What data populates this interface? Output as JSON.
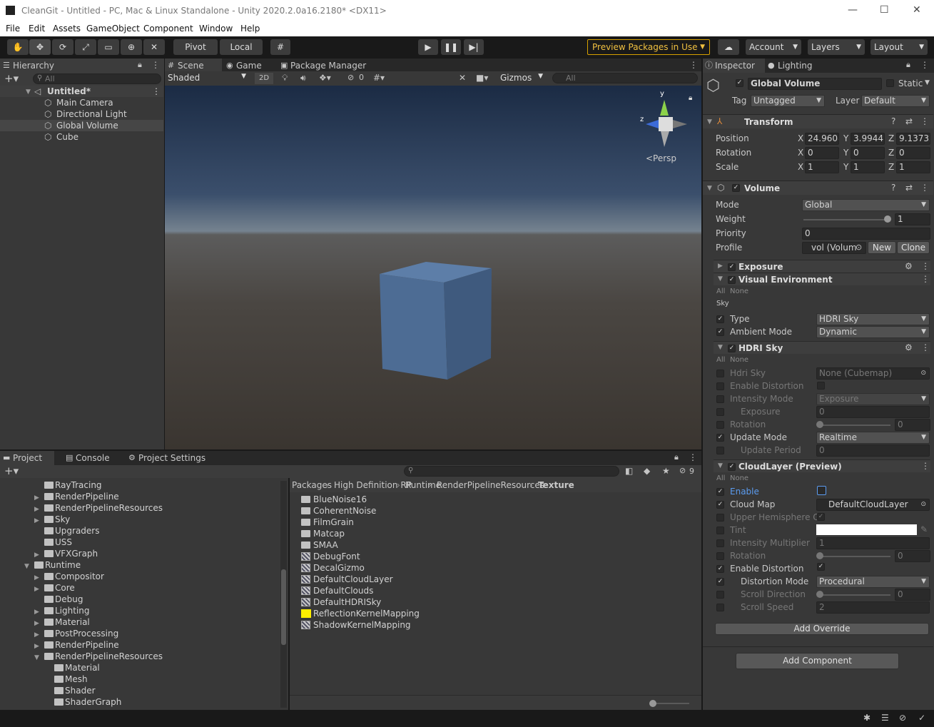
{
  "window": {
    "title": "CleanGit - Untitled - PC, Mac & Linux Standalone - Unity 2020.2.0a16.2180* <DX11>",
    "minimize": "—",
    "maximize": "☐",
    "close": "✕"
  },
  "menu": [
    "File",
    "Edit",
    "Assets",
    "GameObject",
    "Component",
    "Window",
    "Help"
  ],
  "toolbar": {
    "pivot": "Pivot",
    "local": "Local",
    "preview_packages": "Preview Packages in Use",
    "account": "Account",
    "layers": "Layers",
    "layout": "Layout"
  },
  "hierarchy": {
    "tab": "Hierarchy",
    "search_placeholder": "All",
    "scene": "Untitled*",
    "items": [
      "Main Camera",
      "Directional Light",
      "Global Volume",
      "Cube"
    ]
  },
  "scene": {
    "tabs": [
      "Scene",
      "Game",
      "Package Manager"
    ],
    "shading": "Shaded",
    "mode_2d": "2D",
    "hidden_count": "0",
    "gizmos": "Gizmos",
    "search_placeholder": "All",
    "persp": "<Persp",
    "axis_y": "y",
    "axis_x": "x",
    "axis_z": "z"
  },
  "inspector": {
    "tabs": [
      "Inspector",
      "Lighting"
    ],
    "object_name": "Global Volume",
    "static": "Static",
    "tag_label": "Tag",
    "tag": "Untagged",
    "layer_label": "Layer",
    "layer": "Default",
    "transform": {
      "title": "Transform",
      "position_label": "Position",
      "rotation_label": "Rotation",
      "scale_label": "Scale",
      "position": [
        "24.9608",
        "3.9944",
        "9.13732"
      ],
      "rotation": [
        "0",
        "0",
        "0"
      ],
      "scale": [
        "1",
        "1",
        "1"
      ],
      "axes": [
        "X",
        "Y",
        "Z"
      ]
    },
    "volume": {
      "title": "Volume",
      "mode_label": "Mode",
      "mode": "Global",
      "weight_label": "Weight",
      "weight": "1",
      "priority_label": "Priority",
      "priority": "0",
      "profile_label": "Profile",
      "profile": "vol (Volum",
      "new": "New",
      "clone": "Clone"
    },
    "exposure": {
      "title": "Exposure"
    },
    "visual_env": {
      "title": "Visual Environment",
      "all": "All",
      "none": "None",
      "sky": "Sky",
      "type_label": "Type",
      "type": "HDRI Sky",
      "ambient_label": "Ambient Mode",
      "ambient": "Dynamic"
    },
    "hdri": {
      "title": "HDRI Sky",
      "all": "All",
      "none": "None",
      "hdri_label": "Hdri Sky",
      "hdri": "None (Cubemap)",
      "enable_distortion": "Enable Distortion",
      "intensity_mode_label": "Intensity Mode",
      "intensity_mode": "Exposure",
      "exposure_label": "Exposure",
      "exposure": "0",
      "rotation_label": "Rotation",
      "rotation": "0",
      "update_mode_label": "Update Mode",
      "update_mode": "Realtime",
      "update_period_label": "Update Period",
      "update_period": "0"
    },
    "cloud": {
      "title": "CloudLayer (Preview)",
      "all": "All",
      "none": "None",
      "enable": "Enable",
      "cloud_map_label": "Cloud Map",
      "cloud_map": "DefaultCloudLayer",
      "upper": "Upper Hemisphere Or",
      "tint": "Tint",
      "intensity_label": "Intensity Multiplier",
      "intensity": "1",
      "rotation_label": "Rotation",
      "rotation": "0",
      "enable_distortion": "Enable Distortion",
      "distortion_mode_label": "Distortion Mode",
      "distortion_mode": "Procedural",
      "scroll_dir_label": "Scroll Direction",
      "scroll_dir": "0",
      "scroll_speed_label": "Scroll Speed",
      "scroll_speed": "2"
    },
    "add_override": "Add Override",
    "add_component": "Add Component"
  },
  "project": {
    "tabs": [
      "Project",
      "Console",
      "Project Settings"
    ],
    "hidden_count": "9",
    "tree": [
      {
        "label": "RayTracing",
        "indent": 1,
        "arrow": ""
      },
      {
        "label": "RenderPipeline",
        "indent": 1,
        "arrow": "▶"
      },
      {
        "label": "RenderPipelineResources",
        "indent": 1,
        "arrow": "▶"
      },
      {
        "label": "Sky",
        "indent": 1,
        "arrow": "▶"
      },
      {
        "label": "Upgraders",
        "indent": 1,
        "arrow": ""
      },
      {
        "label": "USS",
        "indent": 1,
        "arrow": ""
      },
      {
        "label": "VFXGraph",
        "indent": 1,
        "arrow": "▶"
      },
      {
        "label": "Runtime",
        "indent": 0,
        "arrow": "▼"
      },
      {
        "label": "Compositor",
        "indent": 1,
        "arrow": "▶"
      },
      {
        "label": "Core",
        "indent": 1,
        "arrow": "▶"
      },
      {
        "label": "Debug",
        "indent": 1,
        "arrow": ""
      },
      {
        "label": "Lighting",
        "indent": 1,
        "arrow": "▶"
      },
      {
        "label": "Material",
        "indent": 1,
        "arrow": "▶"
      },
      {
        "label": "PostProcessing",
        "indent": 1,
        "arrow": "▶"
      },
      {
        "label": "RenderPipeline",
        "indent": 1,
        "arrow": "▶"
      },
      {
        "label": "RenderPipelineResources",
        "indent": 1,
        "arrow": "▼"
      },
      {
        "label": "Material",
        "indent": 2,
        "arrow": ""
      },
      {
        "label": "Mesh",
        "indent": 2,
        "arrow": ""
      },
      {
        "label": "Shader",
        "indent": 2,
        "arrow": ""
      },
      {
        "label": "ShaderGraph",
        "indent": 2,
        "arrow": ""
      }
    ],
    "breadcrumb": [
      "Packages",
      "High Definition RP",
      "Runtime",
      "RenderPipelineResources",
      "Texture"
    ],
    "files": [
      {
        "label": "BlueNoise16",
        "kind": "folder"
      },
      {
        "label": "CoherentNoise",
        "kind": "folder"
      },
      {
        "label": "FilmGrain",
        "kind": "folder"
      },
      {
        "label": "Matcap",
        "kind": "folder"
      },
      {
        "label": "SMAA",
        "kind": "folder"
      },
      {
        "label": "DebugFont",
        "kind": "font"
      },
      {
        "label": "DecalGizmo",
        "kind": "tex"
      },
      {
        "label": "DefaultCloudLayer",
        "kind": "tex"
      },
      {
        "label": "DefaultClouds",
        "kind": "tex"
      },
      {
        "label": "DefaultHDRISky",
        "kind": "tex"
      },
      {
        "label": "ReflectionKernelMapping",
        "kind": "yellow"
      },
      {
        "label": "ShadowKernelMapping",
        "kind": "tex"
      }
    ]
  }
}
